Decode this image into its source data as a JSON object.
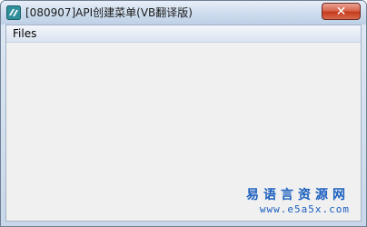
{
  "window": {
    "title": "[080907]API创建菜单(VB翻译版)",
    "close_glyph": "✕"
  },
  "menubar": {
    "items": [
      {
        "label": "Files"
      }
    ]
  },
  "watermark": {
    "line1": "易语言资源网",
    "line2": "www.e5a5x.com"
  },
  "colors": {
    "accent": "#1b5fbf",
    "client_bg": "#f0f0f0",
    "close_red": "#c43a1c"
  }
}
